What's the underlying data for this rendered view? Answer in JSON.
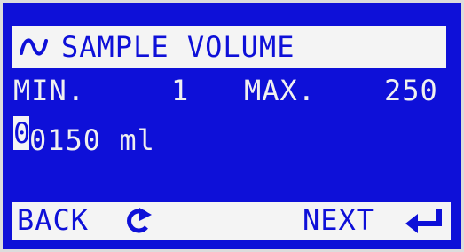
{
  "title": {
    "icon": "sine-wave-icon",
    "text": "SAMPLE VOLUME"
  },
  "range": {
    "min_label": "MIN.",
    "min_value": "1",
    "max_label": "MAX.",
    "max_value": "250"
  },
  "value": {
    "cursor_digit": "0",
    "rest_digits": "0150",
    "unit": "ml"
  },
  "footer": {
    "back_label": "BACK",
    "back_icon": "rotate-back-icon",
    "next_label": "NEXT",
    "next_icon": "enter-arrow-icon"
  },
  "colors": {
    "screen": "#0e10d8",
    "highlight": "#f4f4f4"
  }
}
